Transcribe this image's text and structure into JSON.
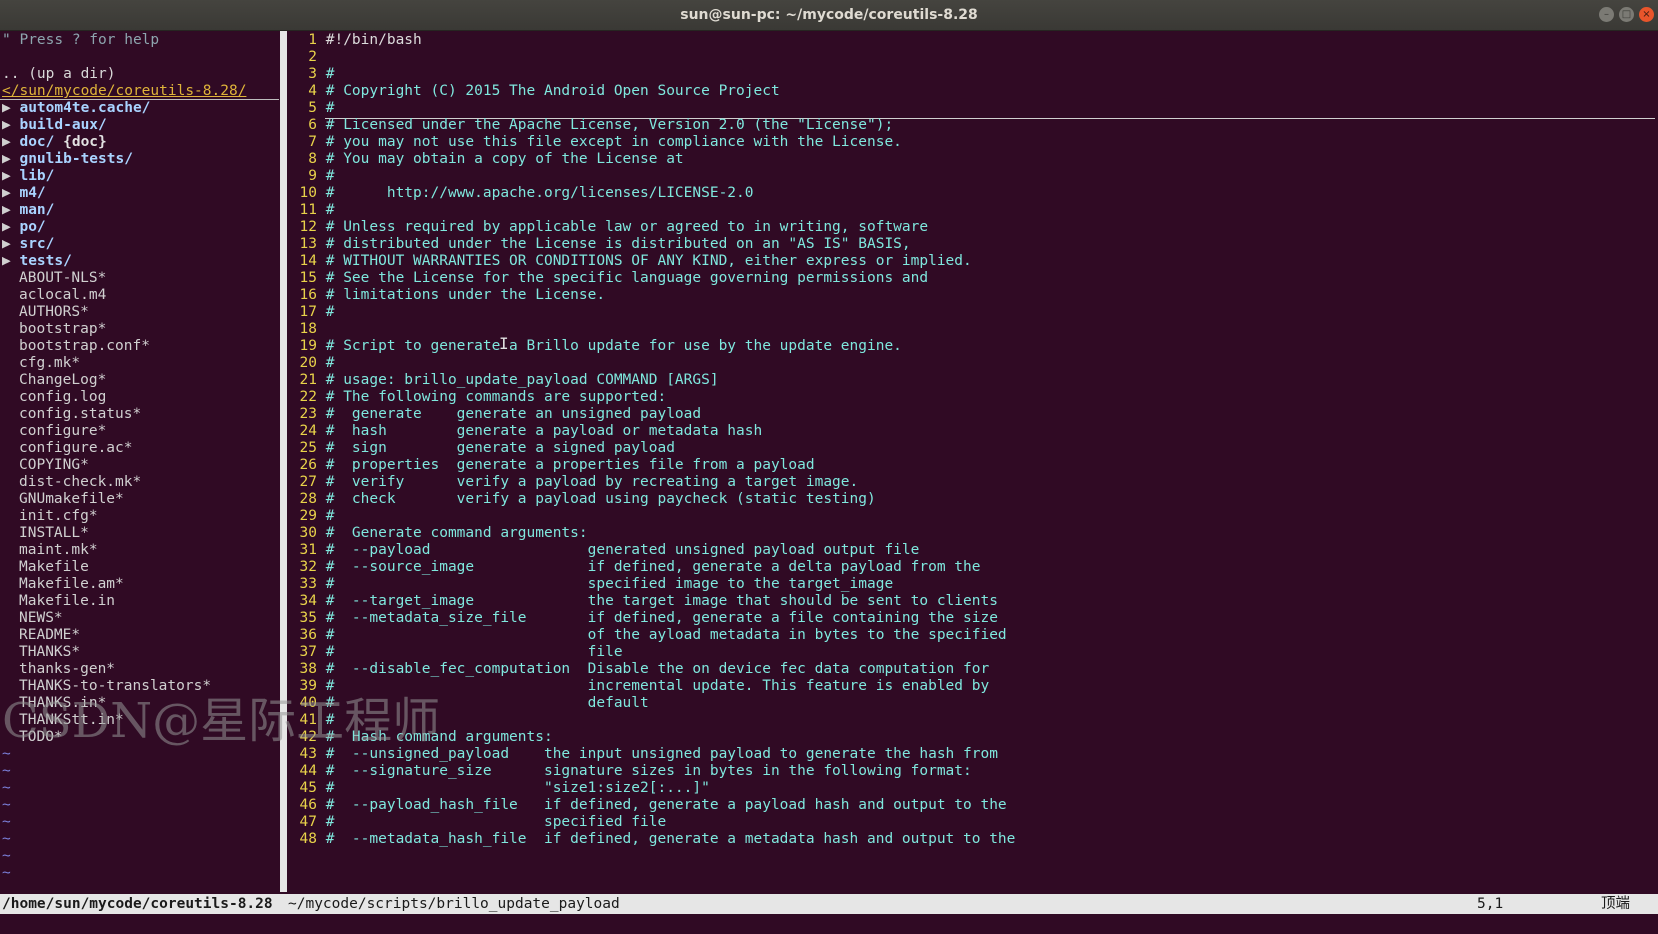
{
  "window": {
    "title": "sun@sun-pc: ~/mycode/coreutils-8.28",
    "controls": {
      "minimize": "–",
      "maximize": "□",
      "close": "×"
    }
  },
  "tree": {
    "help": "\" Press ? for help",
    "updir": ".. (up a dir)",
    "cwd": "</sun/mycode/coreutils-8.28/",
    "dirs": [
      {
        "arrow": "▶",
        "name": "autom4te.cache/"
      },
      {
        "arrow": "▶",
        "name": "build-aux/"
      },
      {
        "arrow": "▶",
        "name": "doc/",
        "tag": "{doc}"
      },
      {
        "arrow": "▶",
        "name": "gnulib-tests/"
      },
      {
        "arrow": "▶",
        "name": "lib/"
      },
      {
        "arrow": "▶",
        "name": "m4/"
      },
      {
        "arrow": "▶",
        "name": "man/"
      },
      {
        "arrow": "▶",
        "name": "po/"
      },
      {
        "arrow": "▶",
        "name": "src/"
      },
      {
        "arrow": "▶",
        "name": "tests/"
      }
    ],
    "files": [
      "ABOUT-NLS*",
      "aclocal.m4",
      "AUTHORS*",
      "bootstrap*",
      "bootstrap.conf*",
      "cfg.mk*",
      "ChangeLog*",
      "config.log",
      "config.status*",
      "configure*",
      "configure.ac*",
      "COPYING*",
      "dist-check.mk*",
      "GNUmakefile*",
      "init.cfg*",
      "INSTALL*",
      "maint.mk*",
      "Makefile",
      "Makefile.am*",
      "Makefile.in",
      "NEWS*",
      "README*",
      "THANKS*",
      "thanks-gen*",
      "THANKS-to-translators*",
      "THANKS.in*",
      "THANKStt.in*",
      "TODO*"
    ],
    "empty_marker": "~"
  },
  "editor": {
    "lines": [
      "#!/bin/bash",
      "",
      "#",
      "# Copyright (C) 2015 The Android Open Source Project",
      "#",
      "# Licensed under the Apache License, Version 2.0 (the \"License\");",
      "# you may not use this file except in compliance with the License.",
      "# You may obtain a copy of the License at",
      "#",
      "#      http://www.apache.org/licenses/LICENSE-2.0",
      "#",
      "# Unless required by applicable law or agreed to in writing, software",
      "# distributed under the License is distributed on an \"AS IS\" BASIS,",
      "# WITHOUT WARRANTIES OR CONDITIONS OF ANY KIND, either express or implied.",
      "# See the License for the specific language governing permissions and",
      "# limitations under the License.",
      "#",
      "",
      "# Script to generate a Brillo update for use by the update engine.",
      "#",
      "# usage: brillo_update_payload COMMAND [ARGS]",
      "# The following commands are supported:",
      "#  generate    generate an unsigned payload",
      "#  hash        generate a payload or metadata hash",
      "#  sign        generate a signed payload",
      "#  properties  generate a properties file from a payload",
      "#  verify      verify a payload by recreating a target image.",
      "#  check       verify a payload using paycheck (static testing)",
      "#",
      "#  Generate command arguments:",
      "#  --payload                  generated unsigned payload output file",
      "#  --source_image             if defined, generate a delta payload from the",
      "#                             specified image to the target_image",
      "#  --target_image             the target image that should be sent to clients",
      "#  --metadata_size_file       if defined, generate a file containing the size",
      "#                             of the ayload metadata in bytes to the specified",
      "#                             file",
      "#  --disable_fec_computation  Disable the on device fec data computation for",
      "#                             incremental update. This feature is enabled by",
      "#                             default",
      "#",
      "#  Hash command arguments:",
      "#  --unsigned_payload    the input unsigned payload to generate the hash from",
      "#  --signature_size      signature sizes in bytes in the following format:",
      "#                        \"size1:size2[:...]\"",
      "#  --payload_hash_file   if defined, generate a payload hash and output to the",
      "#                        specified file",
      "#  --metadata_hash_file  if defined, generate a metadata hash and output to the"
    ]
  },
  "statusline": {
    "tree_path": "/home/sun/mycode/coreutils-8.28",
    "file_path": "~/mycode/scripts/brillo_update_payload",
    "position": "5,1",
    "scroll": "顶端"
  },
  "watermark": "CSDN@星际工程师",
  "colors": {
    "terminal_bg": "#300a24",
    "line_number": "#e8d24a",
    "comment": "#7fe8de",
    "directory": "#a9d3ff",
    "cwd": "#dfb43a",
    "statusline_bg": "#e6e6e6"
  }
}
